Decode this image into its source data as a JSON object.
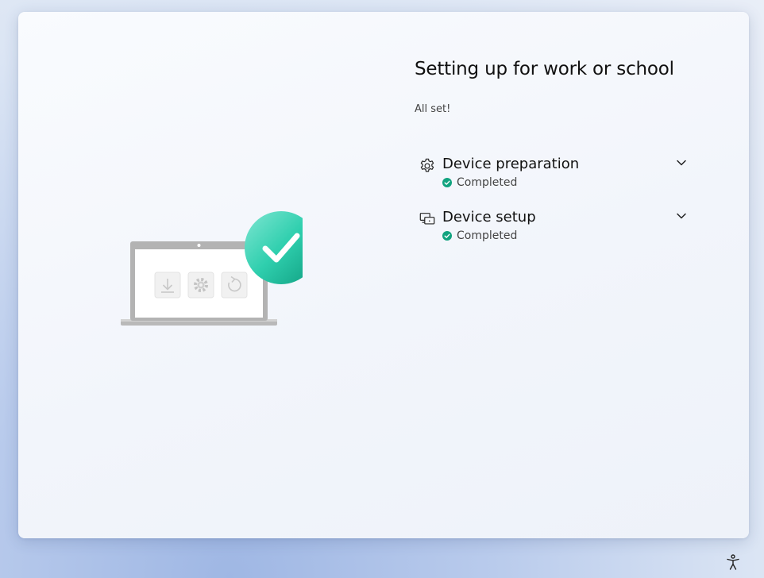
{
  "heading": {
    "title": "Setting up for work or school",
    "subtitle": "All set!"
  },
  "sections": [
    {
      "title": "Device preparation",
      "status": "Completed",
      "icon": "gear-icon",
      "expanded": false
    },
    {
      "title": "Device setup",
      "status": "Completed",
      "icon": "devices-icon",
      "expanded": false
    }
  ],
  "colors": {
    "success": "#11a37f",
    "accent_check": "#2fcfae"
  },
  "footer": {
    "accessibility_icon": "accessibility-icon"
  }
}
